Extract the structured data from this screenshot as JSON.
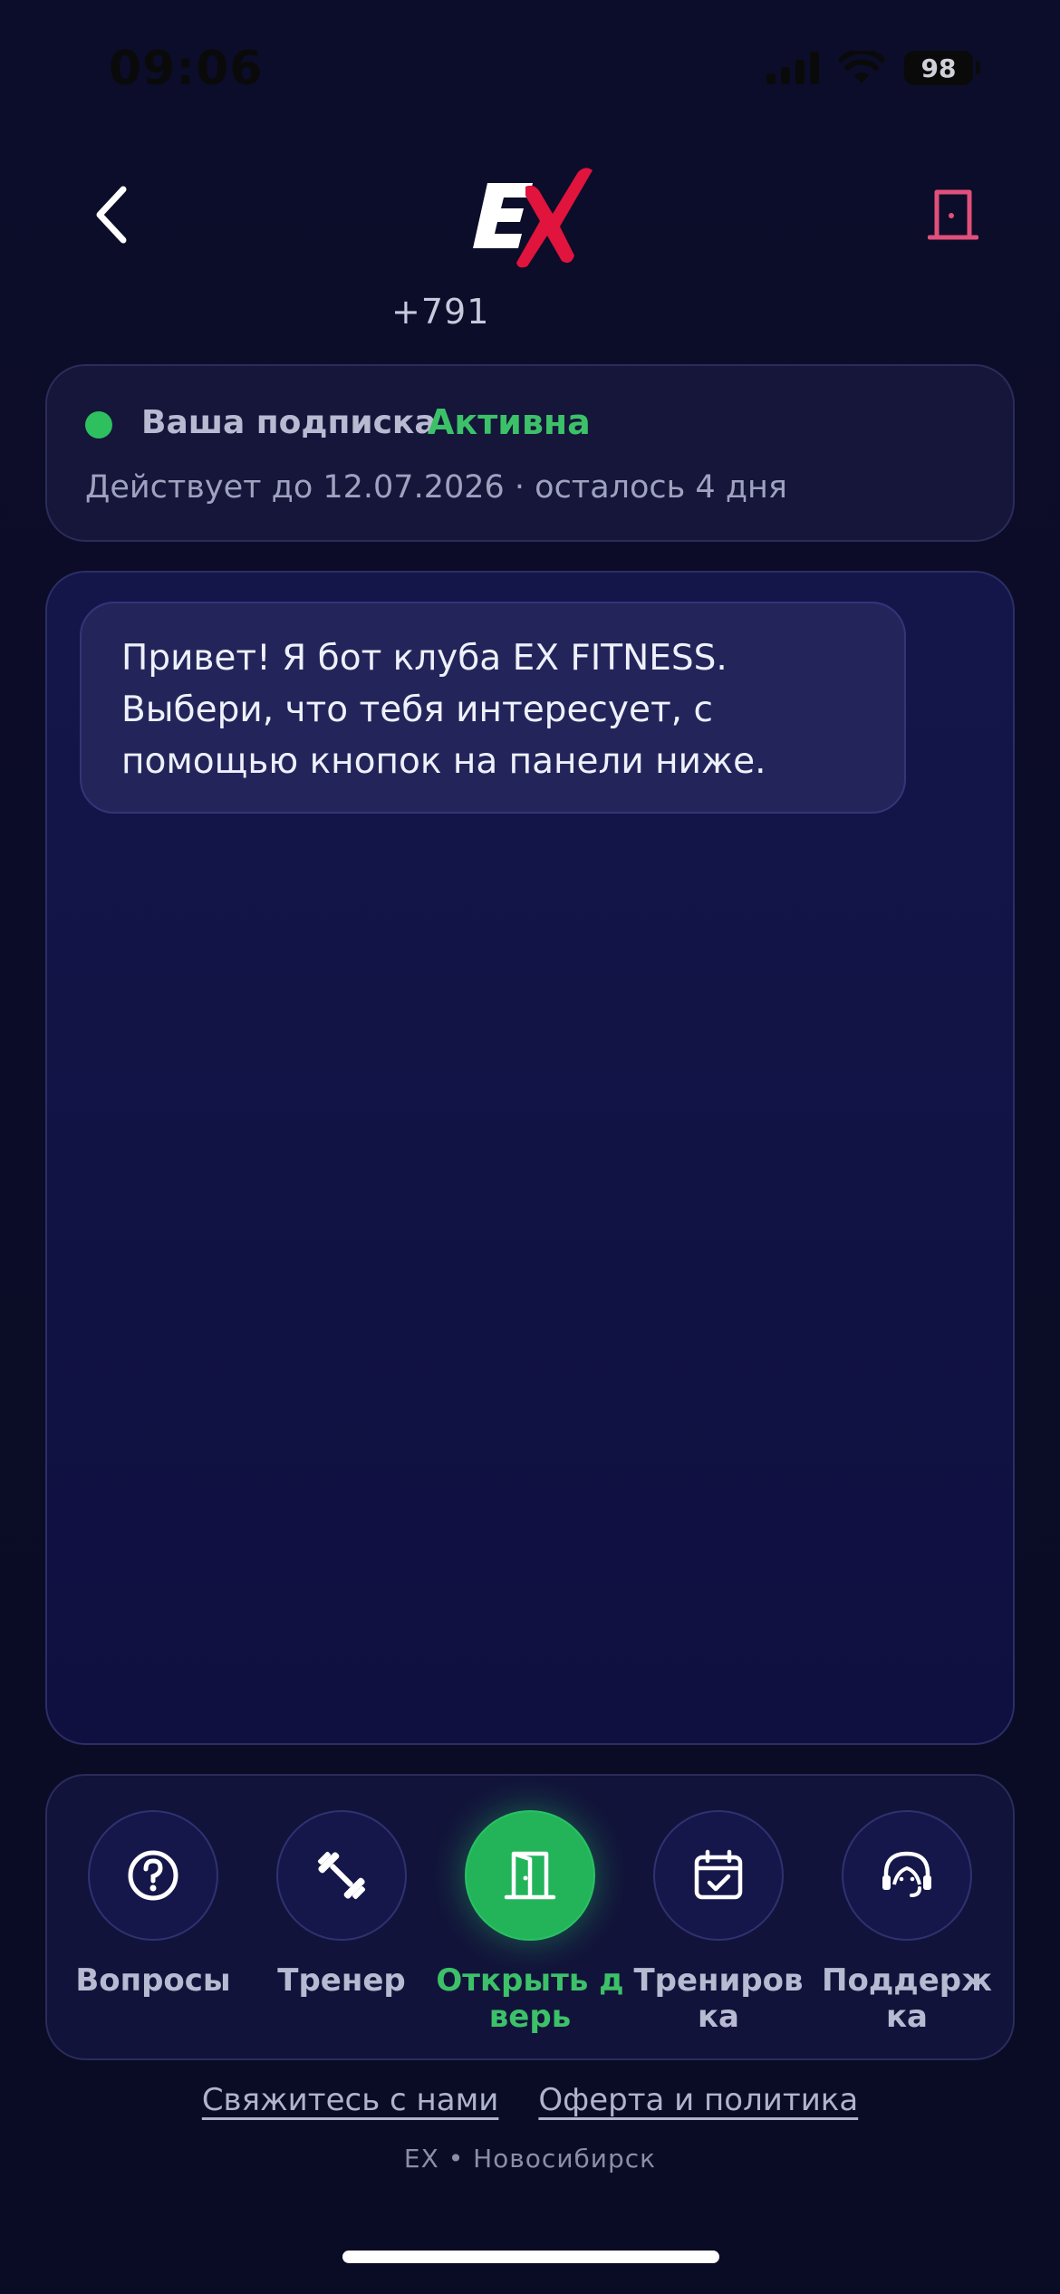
{
  "status_bar": {
    "time": "09:06",
    "battery": "98",
    "icons": [
      "cellular-signal-icon",
      "wifi-icon",
      "battery-icon"
    ]
  },
  "header": {
    "back_icon": "chevron-left-icon",
    "logo_text": "EX",
    "door_icon": "door-icon",
    "phone": "+791"
  },
  "subscription": {
    "label": "Ваша подписка",
    "status": "Активна",
    "detail": "Действует до 12.07.2026 · осталось 4 дня",
    "status_color": "#3cc169"
  },
  "chat": {
    "messages": [
      {
        "text": "Привет! Я бот клуба EX FITNESS.\nВыбери, что тебя интересует, с\nпомощью кнопок на панели ниже."
      }
    ]
  },
  "nav": {
    "items": [
      {
        "label": "Вопросы",
        "icon": "question-icon",
        "active": false
      },
      {
        "label": "Тренер",
        "icon": "dumbbell-icon",
        "active": false
      },
      {
        "label": "Открыть дверь",
        "icon": "door-open-icon",
        "active": true
      },
      {
        "label": "Тренировка",
        "icon": "calendar-check-icon",
        "active": false
      },
      {
        "label": "Поддержка",
        "icon": "headset-icon",
        "active": false
      }
    ]
  },
  "footer": {
    "contact_link": "Свяжитесь с нами",
    "offer_link": "Оферта и политика",
    "caption": "EX • Новосибирск"
  },
  "colors": {
    "background": "#0b0c26",
    "accent_green": "#23b45a",
    "logo_red": "#e0143c",
    "door_pink": "#e0507a"
  }
}
